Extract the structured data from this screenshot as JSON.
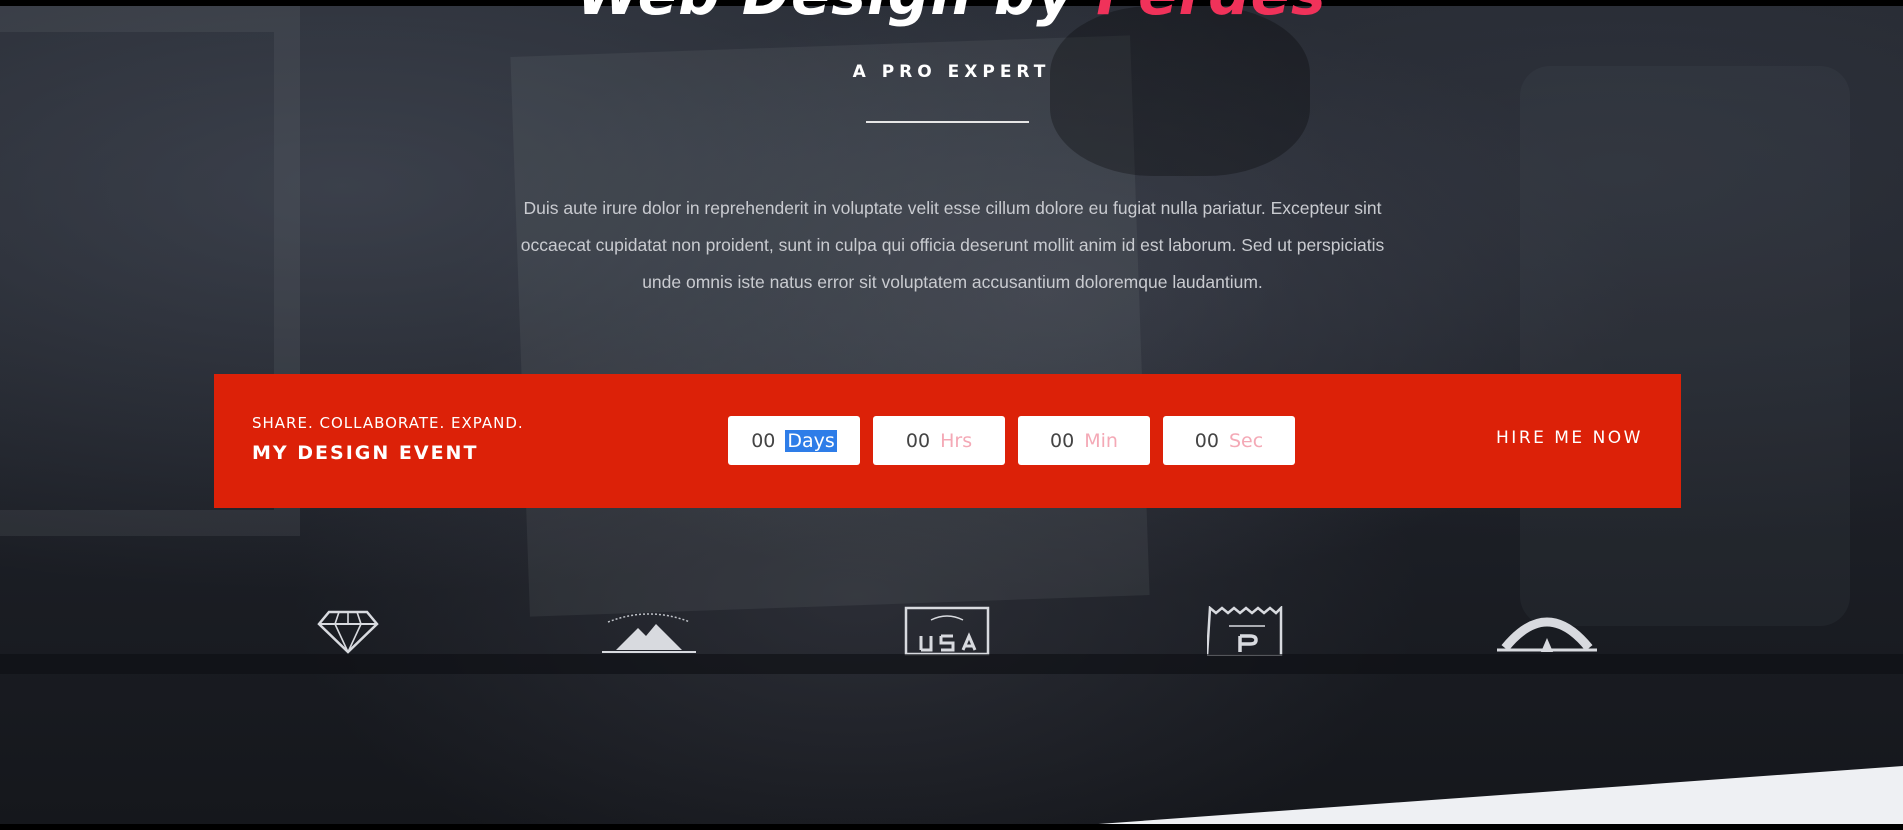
{
  "hero": {
    "headline_prefix": "Web Design by ",
    "headline_accent": "Perdes",
    "subtitle": "A PRO EXPERT",
    "description_lines": [
      "Duis aute irure dolor in reprehenderit in voluptate velit esse cillum dolore eu fugiat nulla pariatur. Excepteur sint",
      "occaecat cupidatat non proident, sunt in culpa qui officia deserunt mollit anim id est laborum. Sed ut perspiciatis",
      "unde omnis iste natus error sit voluptatem accusantium doloremque laudantium."
    ]
  },
  "event": {
    "tagline": "SHARE. COLLABORATE. EXPAND.",
    "name": "MY DESIGN EVENT",
    "countdown": [
      {
        "value": "00",
        "unit": "Days",
        "selected": true
      },
      {
        "value": "00",
        "unit": "Hrs",
        "selected": false
      },
      {
        "value": "00",
        "unit": "Min",
        "selected": false
      },
      {
        "value": "00",
        "unit": "Sec",
        "selected": false
      }
    ],
    "cta_label": "HIRE ME NOW"
  },
  "logos": [
    {
      "icon": "diamond-logo-icon"
    },
    {
      "icon": "mountain-badge-logo-icon"
    },
    {
      "icon": "usa-badge-logo-icon"
    },
    {
      "icon": "b-badge-logo-icon"
    },
    {
      "icon": "arch-a-logo-icon"
    }
  ],
  "colors": {
    "accent_pink": "#f0325a",
    "event_red": "#dc2108",
    "selection_blue": "#2e7de8"
  }
}
